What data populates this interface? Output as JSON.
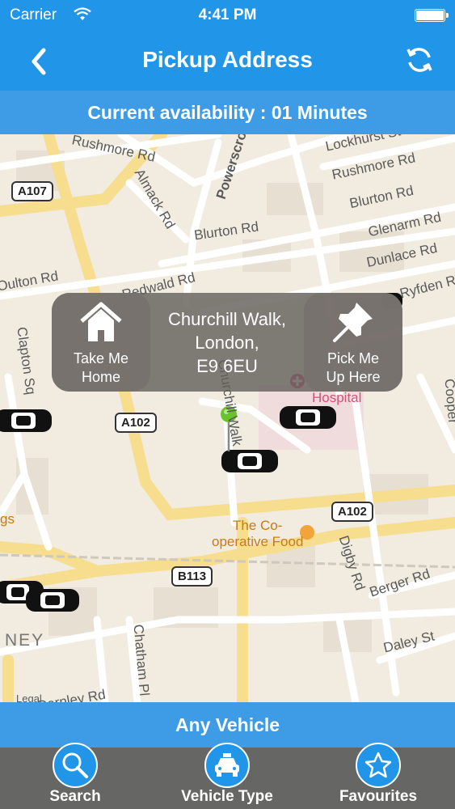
{
  "status_bar": {
    "carrier": "Carrier",
    "time": "4:41 PM"
  },
  "header": {
    "title": "Pickup Address",
    "back_icon": "chevron-left-icon",
    "refresh_icon": "refresh-icon"
  },
  "availability": "Current availability : 01 Minutes",
  "map": {
    "road_labels": [
      "Rushmore Rd",
      "Lockhurst St",
      "Rushmore Rd",
      "Almack Rd",
      "Powerscroft Rd",
      "Blurton Rd",
      "Blurton Rd",
      "Glenarm Rd",
      "Dunlace Rd",
      "Redwald Rd",
      "Oulton Rd",
      "Clapton Sq",
      "Churchill Walk",
      "Ryfden Rd",
      "Cooper",
      "Digby Rd",
      "Berger Rd",
      "Daley St",
      "Chatham Pl",
      "Darnley Rd",
      "Hospital",
      "The Co-\noperative Food",
      "Legal",
      "NEY",
      "gs"
    ],
    "road_signs": [
      "A107",
      "A102",
      "A102",
      "B113"
    ],
    "pin_color": "#6cc12e",
    "hospital_color": "#d6507c"
  },
  "callout": {
    "left_label": "Take Me\nHome",
    "address": "Churchill Walk,\nLondon,\nE9 6EU",
    "right_label": "Pick Me\nUp Here"
  },
  "vehicle_filter": "Any Vehicle",
  "tabs": [
    {
      "label": "Search",
      "icon": "search-icon"
    },
    {
      "label": "Vehicle Type",
      "icon": "taxi-icon"
    },
    {
      "label": "Favourites",
      "icon": "star-icon"
    }
  ],
  "colors": {
    "primary": "#2196e8",
    "secondary": "#3e9be6",
    "tabbar": "#666664"
  }
}
